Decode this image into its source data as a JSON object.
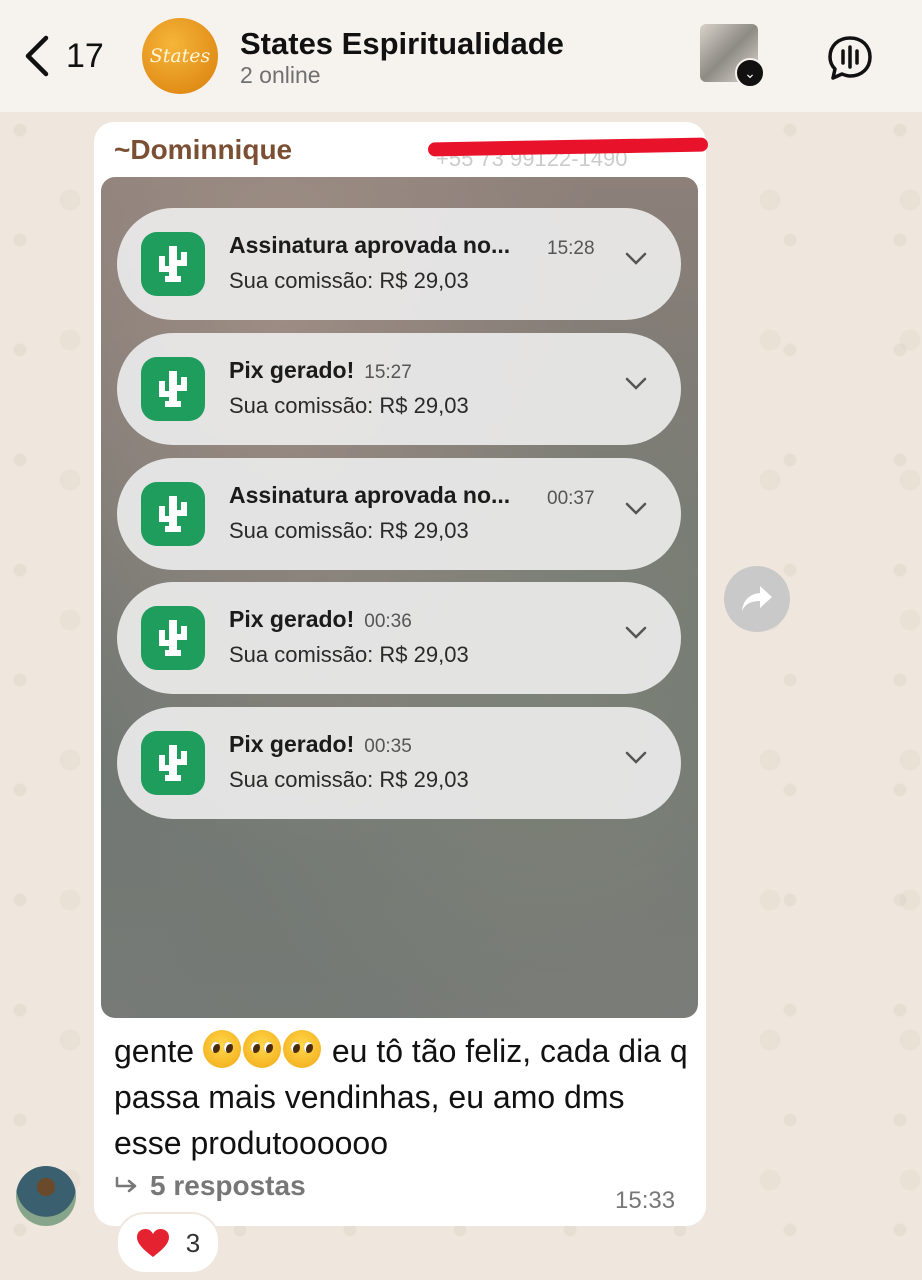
{
  "header": {
    "back_count": "17",
    "avatar_text": "States",
    "title": "States Espiritualidade",
    "status": "2 online"
  },
  "message": {
    "sender": "~Dominnique",
    "redacted_phone_fragment": "+55 73 99122-1490",
    "notifications": [
      {
        "title": "Assinatura aprovada no...",
        "time": "15:28",
        "body": "Sua comissão: R$ 29,03"
      },
      {
        "title": "Pix gerado!",
        "time": "15:27",
        "body": "Sua comissão: R$ 29,03"
      },
      {
        "title": "Assinatura aprovada no...",
        "time": "00:37",
        "body": "Sua comissão: R$ 29,03"
      },
      {
        "title": "Pix gerado!",
        "time": "00:36",
        "body": "Sua comissão: R$ 29,03"
      },
      {
        "title": "Pix gerado!",
        "time": "00:35",
        "body": "Sua comissão: R$ 29,03"
      }
    ],
    "text_prefix": "gente",
    "text_rest": " eu tô tão feliz, cada dia q passa mais vendinhas, eu amo dms esse produtoooooo",
    "replies": "5 respostas",
    "time": "15:33",
    "reaction": {
      "emoji": "heart",
      "count": "3"
    }
  },
  "colors": {
    "wallpaper": "#efe7de",
    "sender_name": "#7b4f33",
    "app_icon": "#1e9d5d",
    "redaction": "#e8132a"
  },
  "icons": [
    "chevron-left-icon",
    "voice-chat-icon",
    "cactus-app-icon",
    "chevron-down-icon",
    "reply-arrow-icon",
    "forward-icon",
    "heart-icon"
  ]
}
